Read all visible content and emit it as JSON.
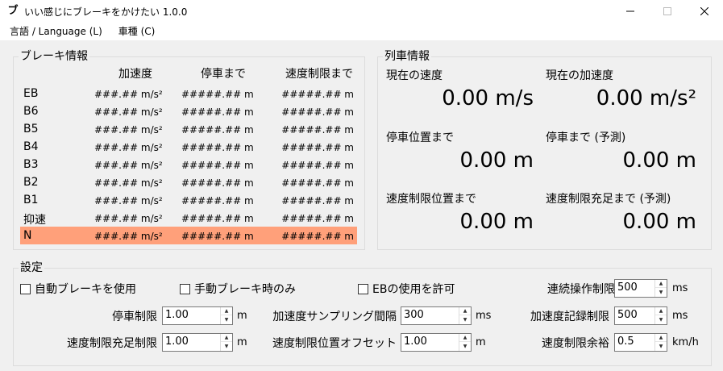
{
  "window": {
    "icon_glyph": "ブ",
    "title": "いい感じにブレーキをかけたい 1.0.0"
  },
  "menu": {
    "items": [
      "言語 / Language (L)",
      "車種 (C)"
    ]
  },
  "brake_info": {
    "title": "ブレーキ情報",
    "headers": {
      "acceleration": "加速度",
      "to_stop": "停車まで",
      "to_speed_limit": "速度制限まで"
    },
    "rows": [
      {
        "name": "EB",
        "acc": "###.## m/s²",
        "stop": "#####.## m",
        "limit": "#####.## m"
      },
      {
        "name": "B6",
        "acc": "###.## m/s²",
        "stop": "#####.## m",
        "limit": "#####.## m"
      },
      {
        "name": "B5",
        "acc": "###.## m/s²",
        "stop": "#####.## m",
        "limit": "#####.## m"
      },
      {
        "name": "B4",
        "acc": "###.## m/s²",
        "stop": "#####.## m",
        "limit": "#####.## m"
      },
      {
        "name": "B3",
        "acc": "###.## m/s²",
        "stop": "#####.## m",
        "limit": "#####.## m"
      },
      {
        "name": "B2",
        "acc": "###.## m/s²",
        "stop": "#####.## m",
        "limit": "#####.## m"
      },
      {
        "name": "B1",
        "acc": "###.## m/s²",
        "stop": "#####.## m",
        "limit": "#####.## m"
      },
      {
        "name": "抑速",
        "acc": "###.## m/s²",
        "stop": "#####.## m",
        "limit": "#####.## m"
      },
      {
        "name": "N",
        "acc": "###.## m/s²",
        "stop": "#####.## m",
        "limit": "#####.## m"
      }
    ],
    "selected_row_color": "#ffa07a"
  },
  "train_info": {
    "title": "列車情報",
    "current_speed_label": "現在の速度",
    "current_speed_value": "0.00 m/s",
    "current_accel_label": "現在の加速度",
    "current_accel_value": "0.00 m/s²",
    "to_stop_pos_label": "停車位置まで",
    "to_stop_pos_value": "0.00 m",
    "to_stop_pred_label": "停車まで (予測)",
    "to_stop_pred_value": "0.00 m",
    "to_limit_pos_label": "速度制限位置まで",
    "to_limit_pos_value": "0.00 m",
    "to_limit_pred_label": "速度制限充足まで (予測)",
    "to_limit_pred_value": "0.00 m"
  },
  "settings": {
    "title": "設定",
    "auto_brake_label": "自動ブレーキを使用",
    "manual_brake_only_label": "手動ブレーキ時のみ",
    "allow_eb_label": "EBの使用を許可",
    "continuous_limit_label": "連続操作制限",
    "continuous_limit_value": "500",
    "continuous_limit_unit": "ms",
    "stop_limit_label": "停車制限",
    "stop_limit_value": "1.00",
    "stop_limit_unit": "m",
    "accel_sampling_label": "加速度サンプリング間隔",
    "accel_sampling_value": "300",
    "accel_sampling_unit": "ms",
    "accel_record_label": "加速度記録制限",
    "accel_record_value": "500",
    "accel_record_unit": "ms",
    "speed_fulfill_label": "速度制限充足制限",
    "speed_fulfill_value": "1.00",
    "speed_fulfill_unit": "m",
    "speed_limit_offset_label": "速度制限位置オフセット",
    "speed_limit_offset_value": "1.00",
    "speed_limit_offset_unit": "m",
    "speed_margin_label": "速度制限余裕",
    "speed_margin_value": "0.5",
    "speed_margin_unit": "km/h"
  }
}
